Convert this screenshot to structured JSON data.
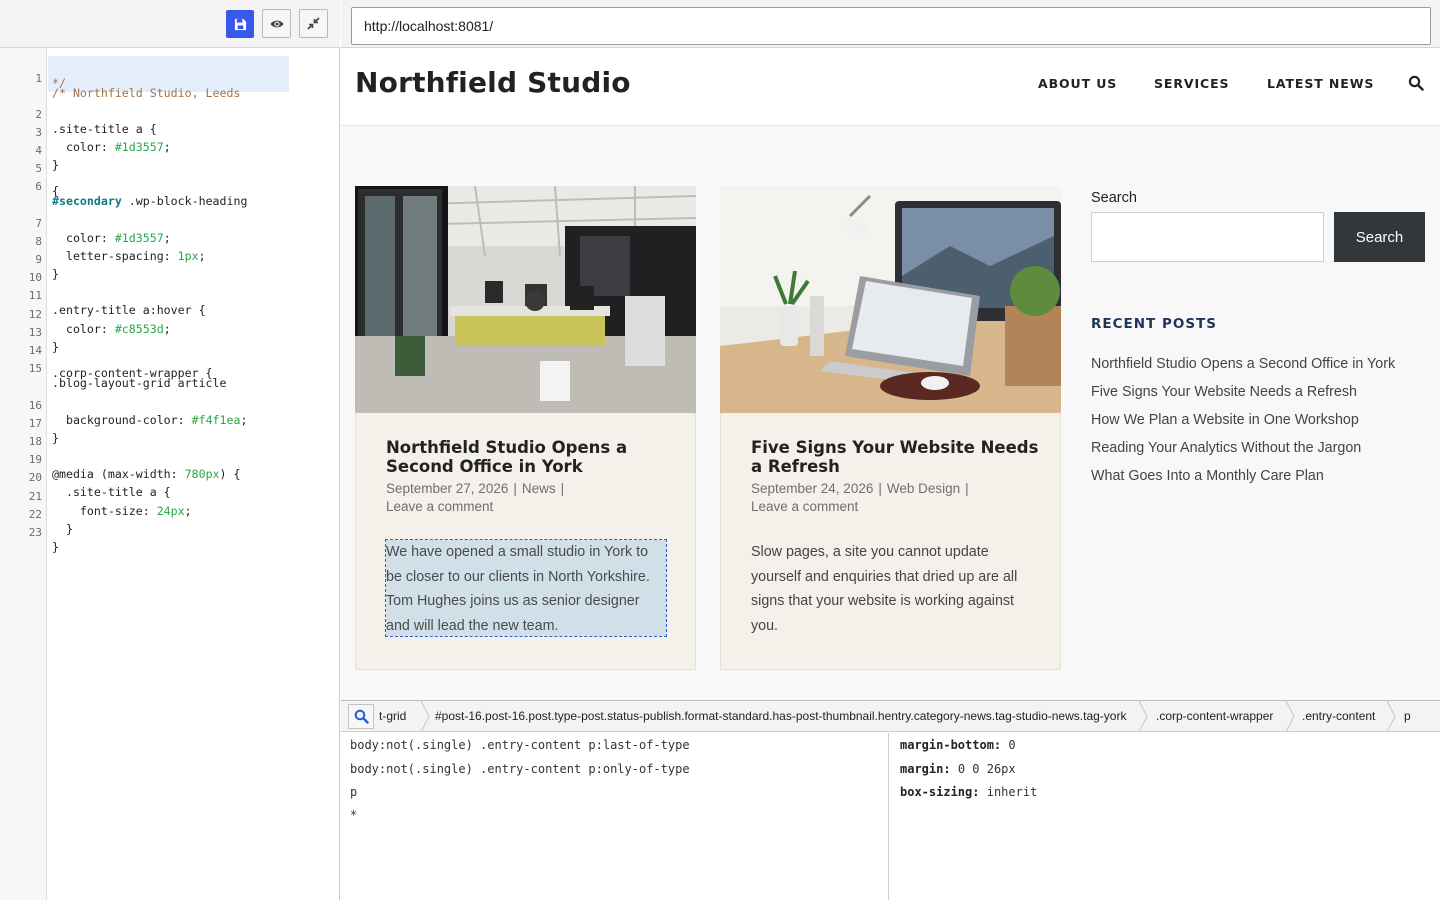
{
  "editor": {
    "toolbar": {
      "save_icon": "save-icon",
      "preview_icon": "eye-icon",
      "collapse_icon": "collapse-icon"
    },
    "lines": [
      {
        "n": "1",
        "text": "/* Northfield Studio, Leeds",
        "cont": "*/"
      },
      {
        "n": "2",
        "text": ".site-title a {"
      },
      {
        "n": "3",
        "text": "  color: #1d3557;"
      },
      {
        "n": "4",
        "text": "}"
      },
      {
        "n": "5",
        "text": ""
      },
      {
        "n": "6",
        "text": "#secondary .wp-block-heading",
        "cont": "{"
      },
      {
        "n": "7",
        "text": "  color: #1d3557;"
      },
      {
        "n": "8",
        "text": "  letter-spacing: 1px;"
      },
      {
        "n": "9",
        "text": "}"
      },
      {
        "n": "10",
        "text": ""
      },
      {
        "n": "11",
        "text": ".entry-title a:hover {"
      },
      {
        "n": "12",
        "text": "  color: #c8553d;"
      },
      {
        "n": "13",
        "text": "}"
      },
      {
        "n": "14",
        "text": ""
      },
      {
        "n": "15",
        "text": ".blog-layout-grid article",
        "cont": ".corp-content-wrapper {"
      },
      {
        "n": "16",
        "text": "  background-color: #f4f1ea;"
      },
      {
        "n": "17",
        "text": "}"
      },
      {
        "n": "18",
        "text": ""
      },
      {
        "n": "19",
        "text": "@media (max-width: 780px) {"
      },
      {
        "n": "20",
        "text": "  .site-title a {"
      },
      {
        "n": "21",
        "text": "    font-size: 24px;"
      },
      {
        "n": "22",
        "text": "  }"
      },
      {
        "n": "23",
        "text": "}"
      }
    ]
  },
  "browser": {
    "url": "http://localhost:8081/"
  },
  "site": {
    "title": "Northfield Studio",
    "nav": [
      "ABOUT US",
      "SERVICES",
      "LATEST NEWS"
    ],
    "nav_search_icon": "search-icon",
    "posts": [
      {
        "title": "Northfield Studio Opens a Second Office in York",
        "date": "September 27, 2026",
        "category": "News",
        "comments": "Leave a comment",
        "excerpt": "We have opened a small studio in York to be closer to our clients in North Yorkshire. Tom Hughes joins us as senior designer and will lead the new team.",
        "image": "open-plan-office-photo"
      },
      {
        "title": "Five Signs Your Website Needs a Refresh",
        "date": "September 24, 2026",
        "category": "Web Design",
        "comments": "Leave a comment",
        "excerpt": "Slow pages, a site you cannot update yourself and enquiries that dried up are all signs that your website is working against you.",
        "image": "desk-laptop-photo"
      }
    ],
    "sidebar": {
      "search_label": "Search",
      "search_button": "Search",
      "recent_heading": "RECENT POSTS",
      "recent_posts": [
        "Northfield Studio Opens a Second Office in York",
        "Five Signs Your Website Needs a Refresh",
        "How We Plan a Website in One Workshop",
        "Reading Your Analytics Without the Jargon",
        "What Goes Into a Monthly Care Plan"
      ]
    }
  },
  "inspector": {
    "search_icon": "magnifier-icon",
    "breadcrumbs": [
      "t-grid",
      "#post-16.post-16.post.type-post.status-publish.format-standard.has-post-thumbnail.hentry.category-news.tag-studio-news.tag-york",
      ".corp-content-wrapper",
      ".entry-content",
      "p"
    ],
    "selectors": [
      "body:not(.single) .entry-content p:last-of-type",
      "body:not(.single) .entry-content p:only-of-type",
      "p",
      "*"
    ],
    "properties": [
      {
        "name": "margin-bottom",
        "value": "0"
      },
      {
        "name": "margin",
        "value": "0 0 26px"
      },
      {
        "name": "box-sizing",
        "value": "inherit"
      }
    ]
  },
  "colors": {
    "accent": "#3858e9",
    "site_title_color": "#1d3557",
    "card_background": "#f4f1ea",
    "hover_color": "#c8553d",
    "button_dark": "#32373c"
  }
}
